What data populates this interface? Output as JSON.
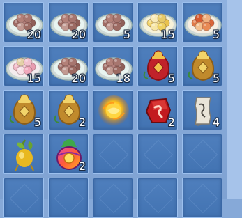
{
  "inventory": {
    "slots": [
      {
        "item": "rice-ball-plate-brown",
        "qty": "20"
      },
      {
        "item": "rice-ball-plate-brown",
        "qty": "20"
      },
      {
        "item": "rice-ball-plate-brown",
        "qty": "5"
      },
      {
        "item": "rice-ball-plate-yellow",
        "qty": "15"
      },
      {
        "item": "rice-ball-plate-red",
        "qty": "5"
      },
      {
        "item": "rice-ball-plate-pink",
        "qty": "15"
      },
      {
        "item": "rice-ball-plate-brown",
        "qty": "20"
      },
      {
        "item": "rice-ball-plate-brown",
        "qty": "18"
      },
      {
        "item": "fortune-bag-red",
        "qty": "5"
      },
      {
        "item": "fortune-bag-gold",
        "qty": "5"
      },
      {
        "item": "fortune-bag-gold",
        "qty": "5"
      },
      {
        "item": "fortune-bag-gold",
        "qty": "2"
      },
      {
        "item": "golden-orb",
        "qty": ""
      },
      {
        "item": "red-rune-stone",
        "qty": "2"
      },
      {
        "item": "paper-scroll",
        "qty": "4"
      },
      {
        "item": "golden-fruit",
        "qty": ""
      },
      {
        "item": "rainbow-bag",
        "qty": "2"
      },
      {
        "item": "empty",
        "qty": ""
      },
      {
        "item": "empty",
        "qty": ""
      },
      {
        "item": "empty",
        "qty": ""
      },
      {
        "item": "empty",
        "qty": ""
      },
      {
        "item": "empty",
        "qty": ""
      },
      {
        "item": "empty",
        "qty": ""
      },
      {
        "item": "empty",
        "qty": ""
      },
      {
        "item": "empty",
        "qty": ""
      }
    ]
  },
  "colors": {
    "slot_bg": "#4a7ab8",
    "slot_border": "#9cc0ee",
    "qty_text": "#ffffff"
  }
}
